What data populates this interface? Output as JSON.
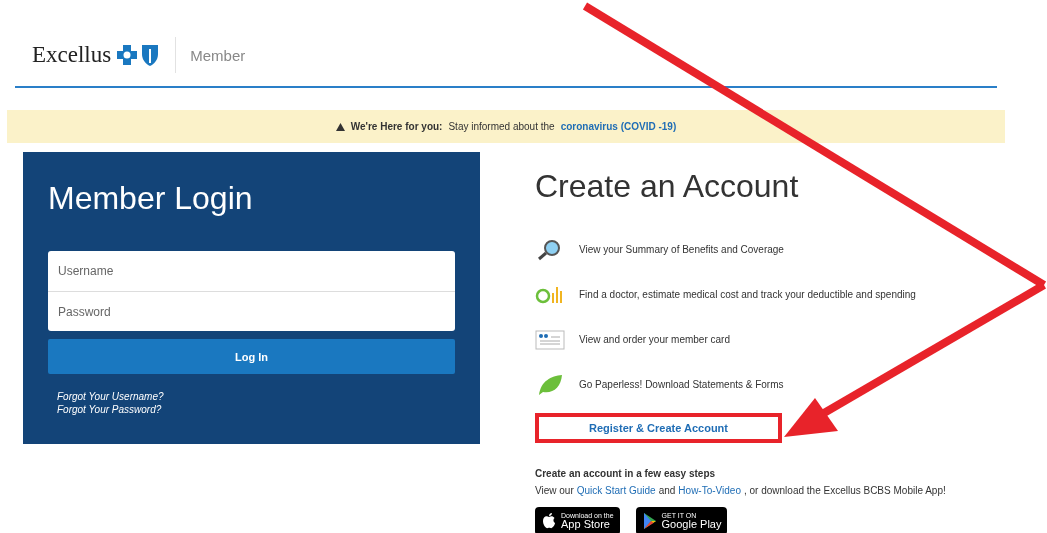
{
  "header": {
    "brand": "Excellus",
    "section": "Member"
  },
  "banner": {
    "lead": "We're Here for you:",
    "text": "Stay informed about the",
    "link": "coronavirus (COVID -19)"
  },
  "login": {
    "title": "Member Login",
    "fields": [
      {
        "placeholder": "Username"
      },
      {
        "placeholder": "Password"
      }
    ],
    "button": "Log In",
    "links": [
      "Forgot Your Username?",
      "Forgot Your Password?"
    ]
  },
  "create": {
    "title": "Create an Account",
    "features": [
      {
        "kind": "magnifier",
        "text": "View your Summary of Benefits and Coverage"
      },
      {
        "kind": "chart",
        "text": "Find a doctor, estimate medical cost and track your deductible and spending"
      },
      {
        "kind": "card",
        "text": "View and order your member card"
      },
      {
        "kind": "leaf",
        "text": "Go Paperless! Download Statements & Forms"
      }
    ],
    "button": "Register & Create Account",
    "steps_title": "Create an account in a few easy steps",
    "steps_parts": [
      {
        "kind": "text",
        "text": "View our"
      },
      {
        "kind": "link",
        "text": "Quick Start Guide"
      },
      {
        "kind": "text",
        "text": "and"
      },
      {
        "kind": "link",
        "text": "How-To-Video"
      },
      {
        "kind": "text",
        "text": ", or download the Excellus BCBS Mobile App!"
      }
    ],
    "badges": [
      {
        "kind": "apple",
        "small": "Download on the",
        "large": "App Store"
      },
      {
        "kind": "google",
        "small": "GET IT ON",
        "large": "Google Play"
      }
    ]
  }
}
